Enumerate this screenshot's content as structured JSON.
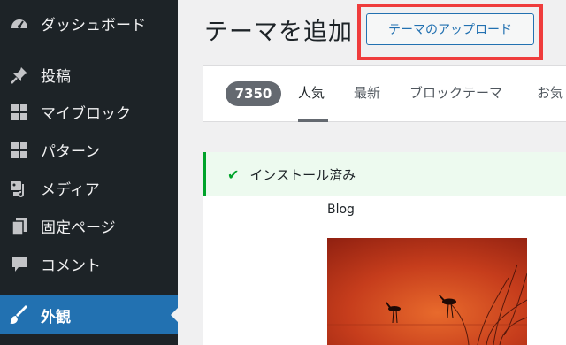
{
  "sidebar": {
    "items": [
      {
        "label": "ダッシュボード",
        "icon": "dashboard-icon"
      },
      {
        "label": "投稿",
        "icon": "pin-icon"
      },
      {
        "label": "マイブロック",
        "icon": "blocks-icon"
      },
      {
        "label": "パターン",
        "icon": "patterns-icon"
      },
      {
        "label": "メディア",
        "icon": "media-icon"
      },
      {
        "label": "固定ページ",
        "icon": "pages-icon"
      },
      {
        "label": "コメント",
        "icon": "comment-icon"
      },
      {
        "label": "外観",
        "icon": "appearance-icon",
        "active": true
      }
    ]
  },
  "header": {
    "title": "テーマを追加",
    "upload_button": "テーマのアップロード"
  },
  "filter_bar": {
    "count": "7350",
    "tabs": [
      "人気",
      "最新",
      "ブロックテーマ",
      "お気"
    ]
  },
  "theme": {
    "notice": "インストール済み",
    "name": "Blog"
  },
  "colors": {
    "sidebar_bg": "#1d2327",
    "active_bg": "#2271b1",
    "highlight": "#ef3c3c",
    "success": "#00a32a"
  }
}
